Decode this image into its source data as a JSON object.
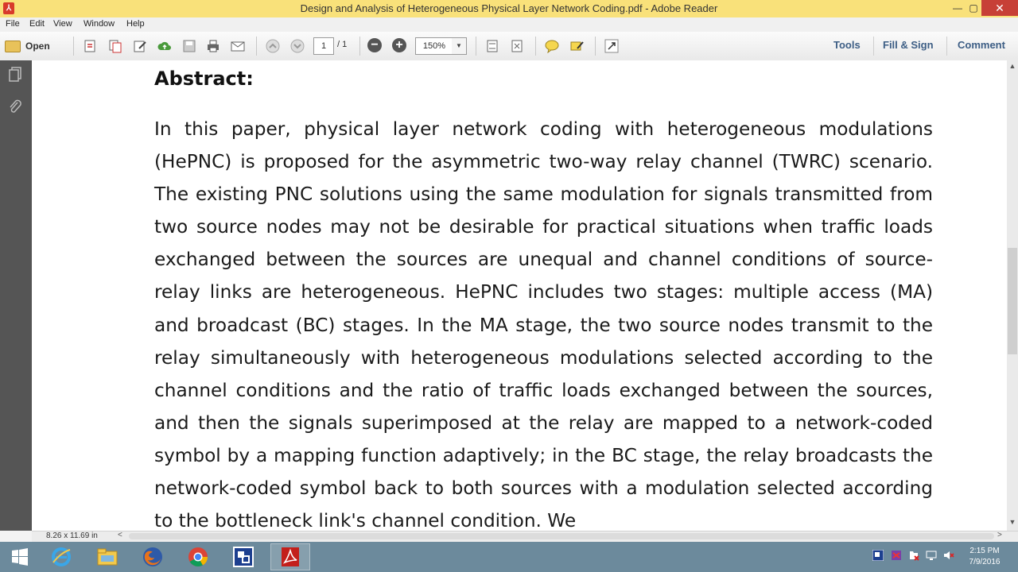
{
  "window": {
    "title": "Design and Analysis of Heterogeneous Physical Layer Network Coding.pdf - Adobe Reader",
    "app_icon": "pdf-icon",
    "minimize_glyph": "—",
    "maximize_glyph": "▢",
    "close_glyph": "✕"
  },
  "menu": [
    "File",
    "Edit",
    "View",
    "Window",
    "Help"
  ],
  "toolbar": {
    "open_label": "Open",
    "page_current": "1",
    "page_total": "/ 1",
    "zoom_value": "150%",
    "tools_label": "Tools",
    "fill_sign_label": "Fill & Sign",
    "comment_label": "Comment"
  },
  "document": {
    "heading": "Abstract:",
    "paragraph": "In this paper, physical layer network coding with heterogeneous modulations (HePNC) is proposed for the asymmetric two-way relay channel (TWRC) scenario. The existing PNC solutions using the same modulation for signals transmitted from two source nodes may not be desirable for practical situations when traffic loads exchanged between the sources are unequal and channel conditions of source-relay links are heterogeneous. HePNC includes two stages: multiple access (MA) and broadcast (BC) stages. In the MA stage, the two source nodes transmit to the relay simultaneously with heterogeneous modulations selected according to the channel conditions and the ratio of traffic loads exchanged between the sources, and then the signals superimposed at the relay are mapped to a network-coded symbol by a mapping function adaptively; in the BC stage, the relay broadcasts the network-coded symbol back to both sources with a modulation selected according to the bottleneck link's channel condition. We"
  },
  "status": {
    "page_size": "8.26 x 11.69 in"
  },
  "taskbar": {
    "clock_time": "2:15 PM",
    "clock_date": "7/9/2016"
  },
  "colors": {
    "title_bar": "#f9e17a",
    "close_button": "#c74037",
    "nav_panel": "#555555",
    "taskbar": "#6c8a9c",
    "tool_link": "#3d5e85"
  }
}
